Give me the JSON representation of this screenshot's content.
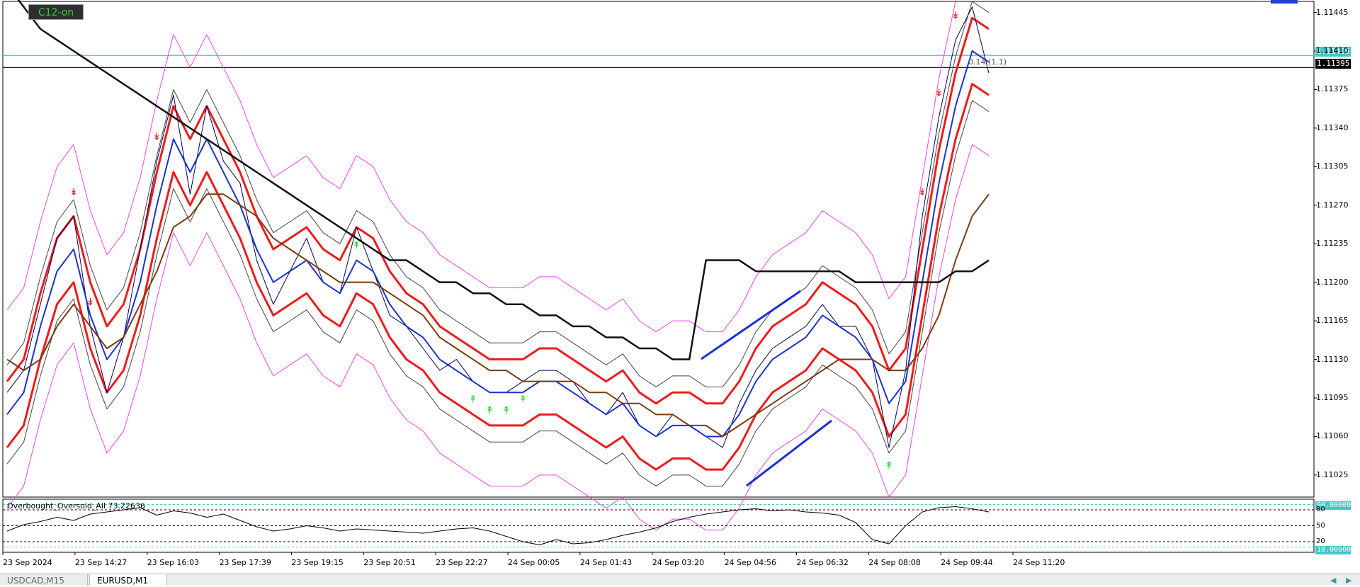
{
  "indicator_button": "C12-on",
  "oscillator_title": "Overbought_Oversold_All 73.22636",
  "spread_text": "0.14 (1.1)",
  "price_tags": {
    "cyan": "1.11406",
    "black": "1.11395"
  },
  "osc_tags": {
    "high": "90.00000",
    "low": "10.00000"
  },
  "colors": {
    "price": "#000050",
    "bands_red": "#ee1c1c",
    "ma_blue": "#1a33cc",
    "ma_brown": "#7a3b10",
    "ma_teal": "#1d8b8b",
    "env_magenta": "#ee44ee",
    "ma200": "#111111",
    "arrow_up": "#22dd22",
    "arrow_down": "#e01818",
    "trend": "#1f2fd6"
  },
  "tabs": [
    "USDCAD,M15",
    "EURUSD,M1"
  ],
  "chart_data": {
    "type": "line",
    "symbol": "EURUSD",
    "timeframe": "M1",
    "ylim": [
      1.11005,
      1.11455
    ],
    "yticks": [
      "1.11445",
      "1.11410",
      "1.11375",
      "1.11340",
      "1.11305",
      "1.11270",
      "1.11235",
      "1.11200",
      "1.11165",
      "1.11130",
      "1.11095",
      "1.11060",
      "1.11025"
    ],
    "xticks": [
      "23 Sep 2024",
      "23 Sep 14:27",
      "23 Sep 16:03",
      "23 Sep 17:39",
      "23 Sep 19:15",
      "23 Sep 20:51",
      "23 Sep 22:27",
      "24 Sep 00:05",
      "24 Sep 01:43",
      "24 Sep 03:20",
      "24 Sep 04:56",
      "24 Sep 06:32",
      "24 Sep 08:08",
      "24 Sep 09:44",
      "24 Sep 11:20"
    ],
    "horizontal_lines": [
      {
        "name": "bid",
        "value": 1.11406,
        "color": "#3ec8c8"
      },
      {
        "name": "last",
        "value": 1.11395,
        "color": "#000000"
      }
    ],
    "series": [
      {
        "role": "price",
        "values": [
          1.111,
          1.1112,
          1.1118,
          1.1124,
          1.1126,
          1.1116,
          1.111,
          1.1115,
          1.1123,
          1.1131,
          1.1137,
          1.1128,
          1.1136,
          1.1131,
          1.1129,
          1.1122,
          1.1118,
          1.1121,
          1.1124,
          1.112,
          1.1119,
          1.1125,
          1.1121,
          1.1117,
          1.1116,
          1.1114,
          1.1112,
          1.1113,
          1.1111,
          1.111,
          1.111,
          1.1111,
          1.1112,
          1.1112,
          1.1111,
          1.1109,
          1.1108,
          1.111,
          1.1107,
          1.1106,
          1.1108,
          1.1107,
          1.1106,
          1.1105,
          1.1109,
          1.1112,
          1.1114,
          1.1115,
          1.1116,
          1.1118,
          1.1116,
          1.1116,
          1.1113,
          1.1105,
          1.1112,
          1.1126,
          1.1135,
          1.1142,
          1.1145,
          1.1139
        ]
      },
      {
        "role": "ma-blue",
        "values": [
          1.1108,
          1.111,
          1.1116,
          1.1121,
          1.1123,
          1.1117,
          1.1113,
          1.1115,
          1.112,
          1.1127,
          1.1133,
          1.113,
          1.1133,
          1.113,
          1.1127,
          1.1123,
          1.112,
          1.1121,
          1.1122,
          1.112,
          1.1119,
          1.1122,
          1.1121,
          1.1118,
          1.1116,
          1.1115,
          1.1113,
          1.1112,
          1.1111,
          1.111,
          1.111,
          1.111,
          1.1111,
          1.1111,
          1.111,
          1.1109,
          1.1108,
          1.1109,
          1.1107,
          1.1106,
          1.1107,
          1.1107,
          1.1106,
          1.1106,
          1.1108,
          1.1111,
          1.1113,
          1.1114,
          1.1115,
          1.1117,
          1.1116,
          1.1115,
          1.1113,
          1.1109,
          1.1111,
          1.112,
          1.1129,
          1.1136,
          1.1141,
          1.114
        ]
      },
      {
        "role": "ma-brown",
        "values": [
          1.1113,
          1.1112,
          1.1113,
          1.1116,
          1.1118,
          1.1116,
          1.1114,
          1.1115,
          1.1118,
          1.1121,
          1.1125,
          1.1126,
          1.1128,
          1.1128,
          1.1127,
          1.1126,
          1.1124,
          1.1123,
          1.1122,
          1.1121,
          1.112,
          1.112,
          1.112,
          1.1119,
          1.1118,
          1.1117,
          1.1115,
          1.1114,
          1.1113,
          1.1112,
          1.1112,
          1.1111,
          1.1111,
          1.1111,
          1.1111,
          1.111,
          1.111,
          1.1109,
          1.1109,
          1.1108,
          1.1108,
          1.1107,
          1.1107,
          1.1106,
          1.1107,
          1.1108,
          1.1109,
          1.111,
          1.1111,
          1.1112,
          1.1113,
          1.1113,
          1.1113,
          1.1112,
          1.1112,
          1.1114,
          1.1117,
          1.1122,
          1.1126,
          1.1128
        ]
      },
      {
        "role": "ma-200",
        "values": [
          1.1147,
          1.1145,
          1.1143,
          1.1142,
          1.1141,
          1.114,
          1.1139,
          1.1138,
          1.1137,
          1.1136,
          1.1135,
          1.1134,
          1.1133,
          1.1132,
          1.1131,
          1.113,
          1.1129,
          1.1128,
          1.1127,
          1.1126,
          1.1125,
          1.1124,
          1.1123,
          1.1122,
          1.1122,
          1.1121,
          1.112,
          1.112,
          1.1119,
          1.1119,
          1.1118,
          1.1118,
          1.1117,
          1.1117,
          1.1116,
          1.1116,
          1.1115,
          1.1115,
          1.1114,
          1.1114,
          1.1113,
          1.1113,
          1.1122,
          1.1122,
          1.1122,
          1.1121,
          1.1121,
          1.1121,
          1.1121,
          1.1121,
          1.1121,
          1.112,
          1.112,
          1.112,
          1.112,
          1.112,
          1.112,
          1.1121,
          1.1121,
          1.1122
        ]
      }
    ],
    "oscillator": {
      "title": "Overbought_Oversold_All 73.22636",
      "ylim": [
        0,
        100
      ],
      "levels": [
        90,
        80,
        50,
        20,
        10
      ],
      "level_labels": [
        "80",
        "50",
        "20"
      ],
      "values": [
        40,
        52,
        58,
        66,
        60,
        72,
        76,
        80,
        84,
        70,
        78,
        74,
        66,
        72,
        60,
        48,
        40,
        44,
        50,
        46,
        40,
        44,
        42,
        40,
        38,
        36,
        40,
        44,
        46,
        40,
        30,
        20,
        14,
        24,
        16,
        18,
        24,
        32,
        38,
        46,
        58,
        66,
        72,
        76,
        80,
        82,
        78,
        80,
        76,
        74,
        70,
        56,
        24,
        16,
        50,
        76,
        84,
        86,
        82,
        76
      ]
    },
    "arrows_down_idx": [
      4,
      5,
      9,
      55,
      56,
      57,
      58
    ],
    "arrows_up_idx": [
      21,
      28,
      29,
      30,
      31,
      53
    ]
  }
}
